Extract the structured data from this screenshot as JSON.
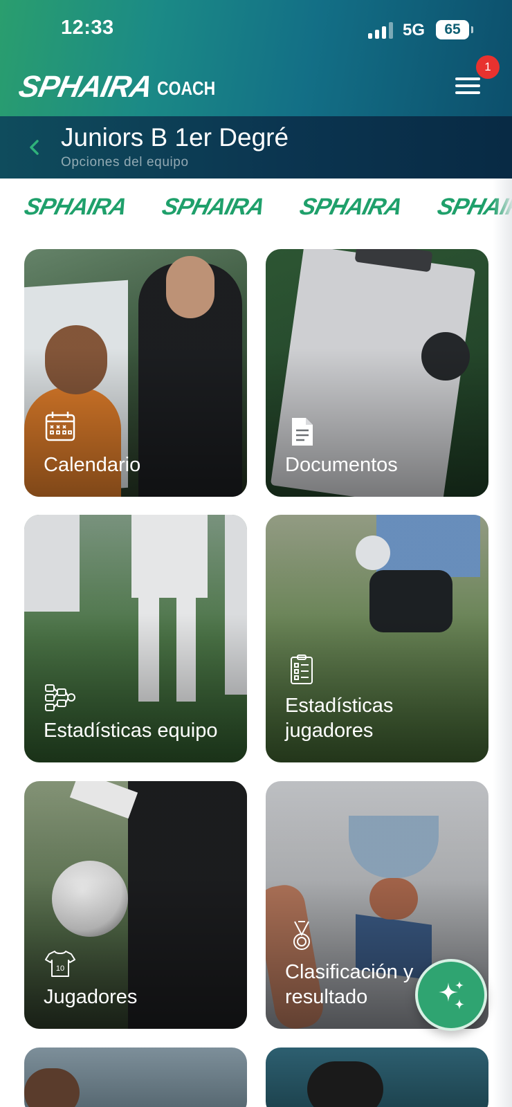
{
  "status_bar": {
    "time": "12:33",
    "network": "5G",
    "battery": "65"
  },
  "header": {
    "brand_main": "SPHAIRA",
    "brand_sub": "COACH",
    "notification_count": "1"
  },
  "team": {
    "title": "Juniors B 1er Degré",
    "subtitle": "Opciones del equipo"
  },
  "strip": {
    "logo_text": "SPHAIRA"
  },
  "cards": [
    {
      "label": "Calendario",
      "icon": "calendar-icon"
    },
    {
      "label": "Documentos",
      "icon": "document-icon"
    },
    {
      "label": "Estadísticas equipo",
      "icon": "team-stats-icon"
    },
    {
      "label": "Estadísticas jugadores",
      "icon": "clipboard-list-icon"
    },
    {
      "label": "Jugadores",
      "icon": "jersey-icon"
    },
    {
      "label": "Clasificación y resultado",
      "icon": "medal-icon"
    }
  ],
  "fab": {
    "icon": "sparkles-icon"
  },
  "colors": {
    "brand_green": "#1fa06b",
    "badge_red": "#e8322f",
    "team_bar": "#0b3550"
  }
}
